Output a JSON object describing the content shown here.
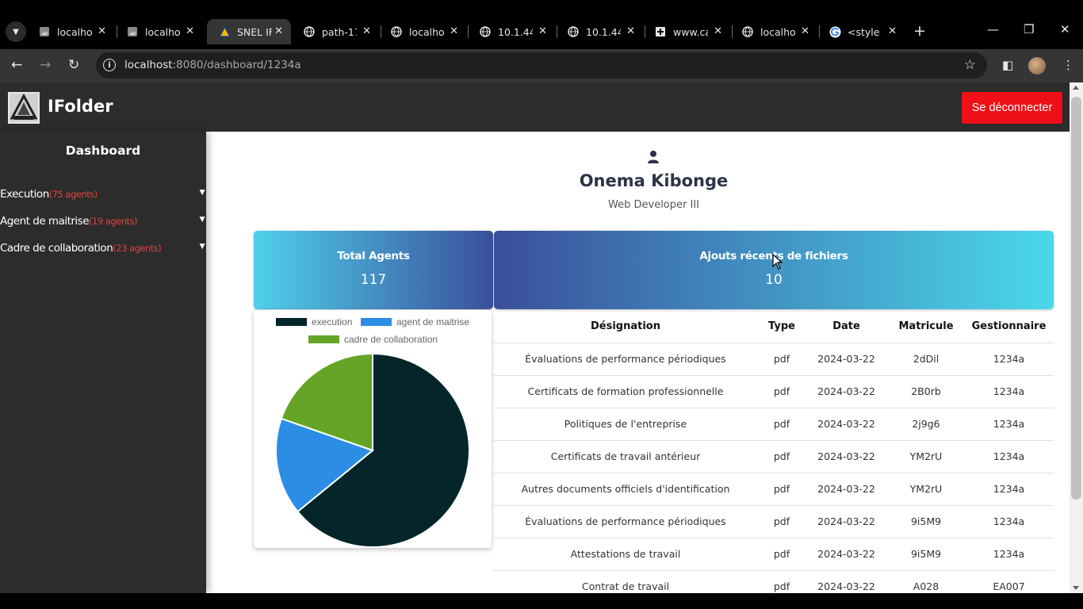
{
  "browser": {
    "tabs": [
      {
        "title": "localho",
        "favicon": "page-icon",
        "active": false
      },
      {
        "title": "localho",
        "favicon": "page-icon",
        "active": false
      },
      {
        "title": "SNEL IF",
        "favicon": "snel-logo-icon",
        "active": true
      },
      {
        "title": "path-17",
        "favicon": "globe-icon",
        "active": false
      },
      {
        "title": "localho",
        "favicon": "globe-icon",
        "active": false
      },
      {
        "title": "10.1.44.",
        "favicon": "globe-icon",
        "active": false
      },
      {
        "title": "10.1.44.",
        "favicon": "globe-icon",
        "active": false
      },
      {
        "title": "www.ca",
        "favicon": "plus-box-icon",
        "active": false
      },
      {
        "title": "localho",
        "favicon": "globe-icon",
        "active": false
      },
      {
        "title": "<style :",
        "favicon": "google-icon",
        "active": false
      }
    ],
    "url_host": "localhost",
    "url_path": ":8080/dashboard/1234a"
  },
  "header": {
    "app_title": "IFolder",
    "logout_label": "Se déconnecter"
  },
  "sidebar": {
    "title": "Dashboard",
    "items": [
      {
        "label": "Execution",
        "count": "(75 agents)"
      },
      {
        "label": "Agent de maitrise",
        "count": "(19 agents)"
      },
      {
        "label": "Cadre de collaboration",
        "count": "(23 agents)"
      }
    ]
  },
  "profile": {
    "name": "Onema Kibonge",
    "role": "Web Developer III"
  },
  "cards": {
    "agents_title": "Total Agents",
    "agents_value": "117",
    "files_title": "Ajouts récents de fichiers",
    "files_value": "10"
  },
  "chart_data": {
    "type": "pie",
    "categories": [
      "execution",
      "agent de maitrise",
      "cadre de collaboration"
    ],
    "values": [
      75,
      19,
      23
    ],
    "colors": [
      "#04252a",
      "#2b8de3",
      "#65a427"
    ],
    "legend_position": "top"
  },
  "table": {
    "headers": [
      "Désignation",
      "Type",
      "Date",
      "Matricule",
      "Gestionnaire"
    ],
    "rows": [
      [
        "Évaluations de performance périodiques",
        "pdf",
        "2024-03-22",
        "2dDil",
        "1234a"
      ],
      [
        "Certificats de formation professionnelle",
        "pdf",
        "2024-03-22",
        "2B0rb",
        "1234a"
      ],
      [
        "Politiques de l'entreprise",
        "pdf",
        "2024-03-22",
        "2j9g6",
        "1234a"
      ],
      [
        "Certificats de travail antérieur",
        "pdf",
        "2024-03-22",
        "YM2rU",
        "1234a"
      ],
      [
        "Autres documents officiels d'identification",
        "pdf",
        "2024-03-22",
        "YM2rU",
        "1234a"
      ],
      [
        "Évaluations de performance périodiques",
        "pdf",
        "2024-03-22",
        "9i5M9",
        "1234a"
      ],
      [
        "Attestations de travail",
        "pdf",
        "2024-03-22",
        "9i5M9",
        "1234a"
      ],
      [
        "Contrat de travail",
        "pdf",
        "2024-03-22",
        "A028",
        "EA007"
      ]
    ]
  }
}
